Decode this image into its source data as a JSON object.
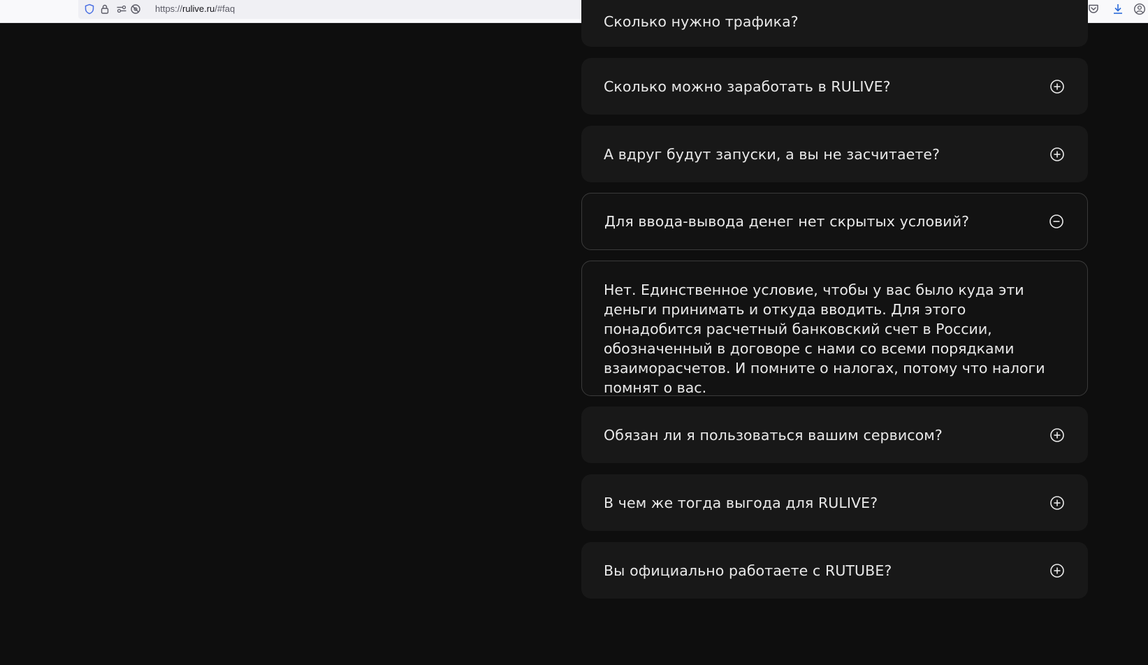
{
  "browser": {
    "url_prefix": "https://",
    "url_host": "rulive.ru",
    "url_path": "/#faq"
  },
  "faq": {
    "partial_question": "Сколько нужно трафика?",
    "items": [
      {
        "question": "Сколько можно заработать в RULIVE?",
        "state": "collapsed"
      },
      {
        "question": "А вдруг будут запуски, а вы не засчитаете?",
        "state": "collapsed"
      },
      {
        "question": "Для ввода-вывода денег нет скрытых условий?",
        "state": "expanded"
      },
      {
        "question": "Обязан ли я пользоваться вашим сервисом?",
        "state": "collapsed"
      },
      {
        "question": "В чем же тогда выгода для RULIVE?",
        "state": "collapsed"
      },
      {
        "question": "Вы официально работаете с RUTUBE?",
        "state": "collapsed"
      }
    ],
    "answer": "Нет. Единственное условие, чтобы у вас было куда эти деньги принимать и откуда вводить. Для этого понадобится расчетный банковский счет в России, обозначенный в договоре с нами со всеми порядками взаиморасчетов. И помните о налогах, потому что налоги помнят о вас."
  },
  "colors": {
    "page_background": "#0e0e0e",
    "card_background": "#181818",
    "text": "#e9e9e9",
    "open_border": "#3a3a3a"
  }
}
